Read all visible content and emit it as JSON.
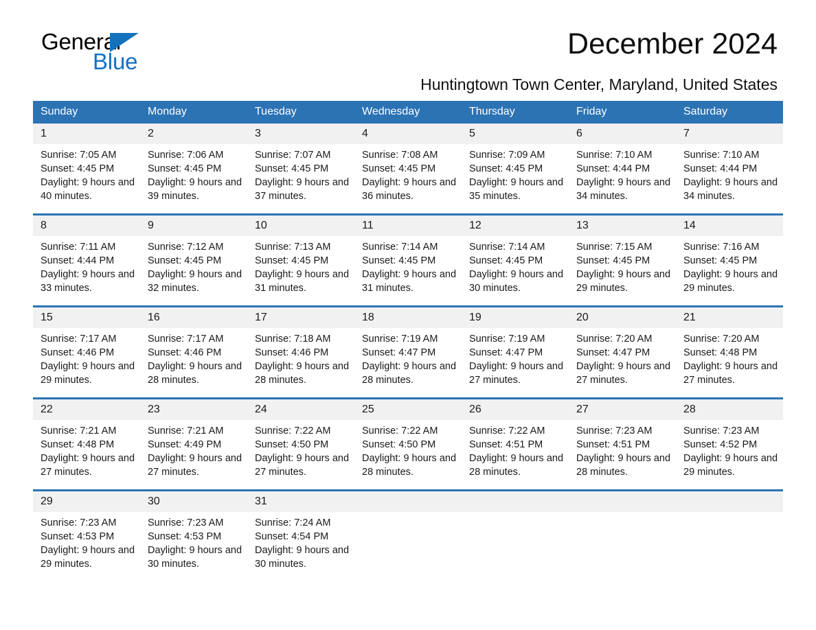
{
  "brand": {
    "name_part1": "General",
    "name_part2": "Blue",
    "accent_color": "#1072c6",
    "triangle_icon": "blue-triangle-icon"
  },
  "header": {
    "month_title": "December 2024",
    "location": "Huntingtown Town Center, Maryland, United States"
  },
  "calendar": {
    "header_color": "#2c73b4",
    "daynum_band_color": "#f1f1f1",
    "weekdays": [
      "Sunday",
      "Monday",
      "Tuesday",
      "Wednesday",
      "Thursday",
      "Friday",
      "Saturday"
    ],
    "weeks": [
      [
        {
          "day": "1",
          "sunrise": "Sunrise: 7:05 AM",
          "sunset": "Sunset: 4:45 PM",
          "daylight": "Daylight: 9 hours and 40 minutes."
        },
        {
          "day": "2",
          "sunrise": "Sunrise: 7:06 AM",
          "sunset": "Sunset: 4:45 PM",
          "daylight": "Daylight: 9 hours and 39 minutes."
        },
        {
          "day": "3",
          "sunrise": "Sunrise: 7:07 AM",
          "sunset": "Sunset: 4:45 PM",
          "daylight": "Daylight: 9 hours and 37 minutes."
        },
        {
          "day": "4",
          "sunrise": "Sunrise: 7:08 AM",
          "sunset": "Sunset: 4:45 PM",
          "daylight": "Daylight: 9 hours and 36 minutes."
        },
        {
          "day": "5",
          "sunrise": "Sunrise: 7:09 AM",
          "sunset": "Sunset: 4:45 PM",
          "daylight": "Daylight: 9 hours and 35 minutes."
        },
        {
          "day": "6",
          "sunrise": "Sunrise: 7:10 AM",
          "sunset": "Sunset: 4:44 PM",
          "daylight": "Daylight: 9 hours and 34 minutes."
        },
        {
          "day": "7",
          "sunrise": "Sunrise: 7:10 AM",
          "sunset": "Sunset: 4:44 PM",
          "daylight": "Daylight: 9 hours and 34 minutes."
        }
      ],
      [
        {
          "day": "8",
          "sunrise": "Sunrise: 7:11 AM",
          "sunset": "Sunset: 4:44 PM",
          "daylight": "Daylight: 9 hours and 33 minutes."
        },
        {
          "day": "9",
          "sunrise": "Sunrise: 7:12 AM",
          "sunset": "Sunset: 4:45 PM",
          "daylight": "Daylight: 9 hours and 32 minutes."
        },
        {
          "day": "10",
          "sunrise": "Sunrise: 7:13 AM",
          "sunset": "Sunset: 4:45 PM",
          "daylight": "Daylight: 9 hours and 31 minutes."
        },
        {
          "day": "11",
          "sunrise": "Sunrise: 7:14 AM",
          "sunset": "Sunset: 4:45 PM",
          "daylight": "Daylight: 9 hours and 31 minutes."
        },
        {
          "day": "12",
          "sunrise": "Sunrise: 7:14 AM",
          "sunset": "Sunset: 4:45 PM",
          "daylight": "Daylight: 9 hours and 30 minutes."
        },
        {
          "day": "13",
          "sunrise": "Sunrise: 7:15 AM",
          "sunset": "Sunset: 4:45 PM",
          "daylight": "Daylight: 9 hours and 29 minutes."
        },
        {
          "day": "14",
          "sunrise": "Sunrise: 7:16 AM",
          "sunset": "Sunset: 4:45 PM",
          "daylight": "Daylight: 9 hours and 29 minutes."
        }
      ],
      [
        {
          "day": "15",
          "sunrise": "Sunrise: 7:17 AM",
          "sunset": "Sunset: 4:46 PM",
          "daylight": "Daylight: 9 hours and 29 minutes."
        },
        {
          "day": "16",
          "sunrise": "Sunrise: 7:17 AM",
          "sunset": "Sunset: 4:46 PM",
          "daylight": "Daylight: 9 hours and 28 minutes."
        },
        {
          "day": "17",
          "sunrise": "Sunrise: 7:18 AM",
          "sunset": "Sunset: 4:46 PM",
          "daylight": "Daylight: 9 hours and 28 minutes."
        },
        {
          "day": "18",
          "sunrise": "Sunrise: 7:19 AM",
          "sunset": "Sunset: 4:47 PM",
          "daylight": "Daylight: 9 hours and 28 minutes."
        },
        {
          "day": "19",
          "sunrise": "Sunrise: 7:19 AM",
          "sunset": "Sunset: 4:47 PM",
          "daylight": "Daylight: 9 hours and 27 minutes."
        },
        {
          "day": "20",
          "sunrise": "Sunrise: 7:20 AM",
          "sunset": "Sunset: 4:47 PM",
          "daylight": "Daylight: 9 hours and 27 minutes."
        },
        {
          "day": "21",
          "sunrise": "Sunrise: 7:20 AM",
          "sunset": "Sunset: 4:48 PM",
          "daylight": "Daylight: 9 hours and 27 minutes."
        }
      ],
      [
        {
          "day": "22",
          "sunrise": "Sunrise: 7:21 AM",
          "sunset": "Sunset: 4:48 PM",
          "daylight": "Daylight: 9 hours and 27 minutes."
        },
        {
          "day": "23",
          "sunrise": "Sunrise: 7:21 AM",
          "sunset": "Sunset: 4:49 PM",
          "daylight": "Daylight: 9 hours and 27 minutes."
        },
        {
          "day": "24",
          "sunrise": "Sunrise: 7:22 AM",
          "sunset": "Sunset: 4:50 PM",
          "daylight": "Daylight: 9 hours and 27 minutes."
        },
        {
          "day": "25",
          "sunrise": "Sunrise: 7:22 AM",
          "sunset": "Sunset: 4:50 PM",
          "daylight": "Daylight: 9 hours and 28 minutes."
        },
        {
          "day": "26",
          "sunrise": "Sunrise: 7:22 AM",
          "sunset": "Sunset: 4:51 PM",
          "daylight": "Daylight: 9 hours and 28 minutes."
        },
        {
          "day": "27",
          "sunrise": "Sunrise: 7:23 AM",
          "sunset": "Sunset: 4:51 PM",
          "daylight": "Daylight: 9 hours and 28 minutes."
        },
        {
          "day": "28",
          "sunrise": "Sunrise: 7:23 AM",
          "sunset": "Sunset: 4:52 PM",
          "daylight": "Daylight: 9 hours and 29 minutes."
        }
      ],
      [
        {
          "day": "29",
          "sunrise": "Sunrise: 7:23 AM",
          "sunset": "Sunset: 4:53 PM",
          "daylight": "Daylight: 9 hours and 29 minutes."
        },
        {
          "day": "30",
          "sunrise": "Sunrise: 7:23 AM",
          "sunset": "Sunset: 4:53 PM",
          "daylight": "Daylight: 9 hours and 30 minutes."
        },
        {
          "day": "31",
          "sunrise": "Sunrise: 7:24 AM",
          "sunset": "Sunset: 4:54 PM",
          "daylight": "Daylight: 9 hours and 30 minutes."
        },
        {
          "day": "",
          "sunrise": "",
          "sunset": "",
          "daylight": ""
        },
        {
          "day": "",
          "sunrise": "",
          "sunset": "",
          "daylight": ""
        },
        {
          "day": "",
          "sunrise": "",
          "sunset": "",
          "daylight": ""
        },
        {
          "day": "",
          "sunrise": "",
          "sunset": "",
          "daylight": ""
        }
      ]
    ]
  }
}
